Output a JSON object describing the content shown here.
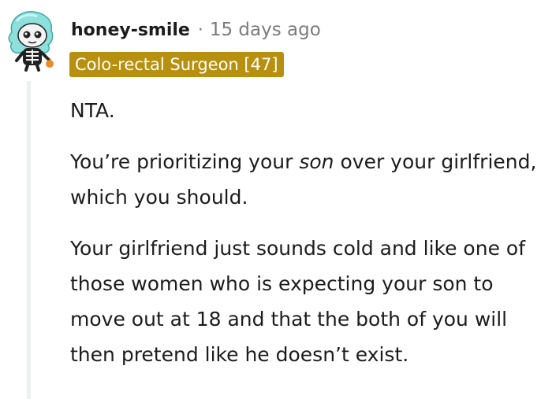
{
  "comment": {
    "author": "honey-smile",
    "separator": "·",
    "time": "15 days ago",
    "flair": "Colo-rectal Surgeon [47]",
    "avatar_icon": "skeleton-snoo-avatar-icon",
    "paragraphs": {
      "p1": "NTA.",
      "p2_before": "You’re prioritizing your ",
      "p2_emph": "son",
      "p2_after": " over your girlfriend, which you should.",
      "p3": "Your girlfriend just sounds cold and like one of those women who is expecting your son to move out at 18 and that the both of you will then pretend like he doesn’t exist."
    }
  },
  "colors": {
    "flair_bg": "#b8900f",
    "thread_line": "#edeff1",
    "meta_text": "#7c7c7c",
    "avatar_hair": "#8ee0dd"
  }
}
